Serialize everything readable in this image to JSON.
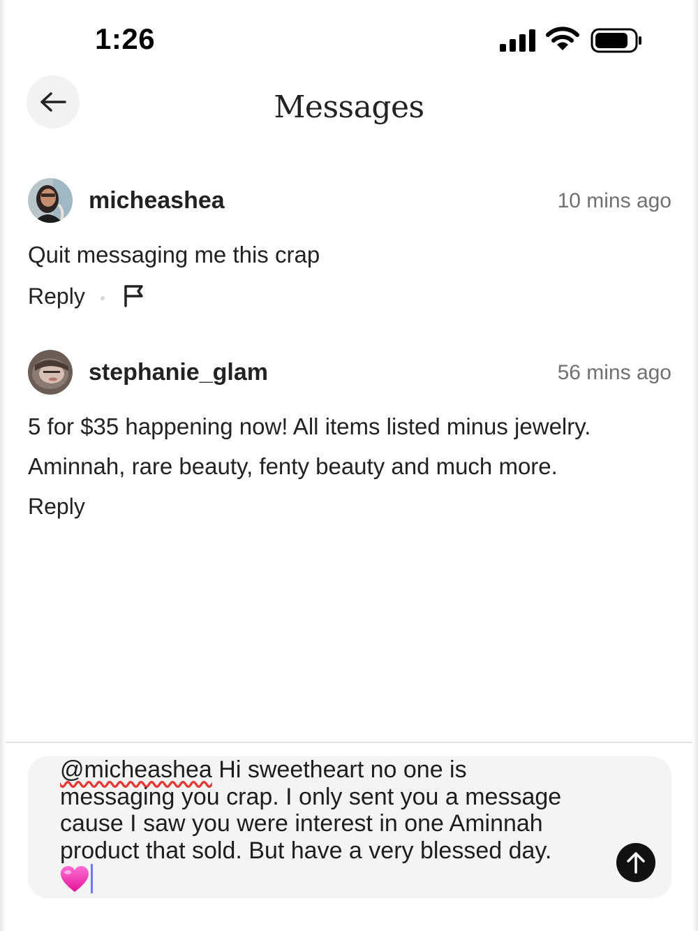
{
  "status_bar": {
    "time": "1:26"
  },
  "header": {
    "title": "Messages"
  },
  "messages": [
    {
      "username": "micheashea",
      "timestamp": "10 mins ago",
      "text": "Quit messaging me this crap",
      "reply_label": "Reply",
      "has_flag": true
    },
    {
      "username": "stephanie_glam",
      "timestamp": "56 mins ago",
      "text_lines": [
        "5 for $35 happening now! All items listed minus jewelry.",
        "Aminnah, rare beauty, fenty beauty and much more."
      ],
      "reply_label": "Reply",
      "has_flag": false
    }
  ],
  "composer": {
    "mention": "@micheashea",
    "line1_rest": " Hi sweetheart no one is",
    "line2": "messaging you crap. I only sent you a message",
    "line3": "cause I saw you were interest in one Aminnah",
    "line4": "product that sold. But have a very blessed day.",
    "emoji": "pink-heart"
  },
  "icons": {
    "back": "arrow-left-icon",
    "send": "arrow-up-icon",
    "flag": "flag-icon",
    "signal": "cellular-signal-icon",
    "wifi": "wifi-icon",
    "battery": "battery-icon"
  },
  "colors": {
    "accent": "#111111",
    "caret": "#6b7cf2",
    "spellcheck": "#e53935",
    "timestamp": "#707070"
  }
}
